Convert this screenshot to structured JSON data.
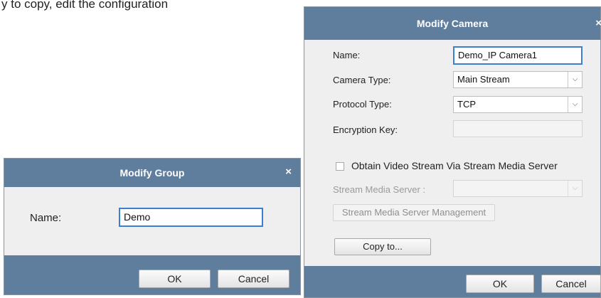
{
  "background_text": "y to copy, edit the configuration",
  "modify_group": {
    "title": "Modify Group",
    "close_glyph": "×",
    "name_label": "Name:",
    "name_value": "Demo",
    "ok_label": "OK",
    "cancel_label": "Cancel"
  },
  "modify_camera": {
    "title": "Modify Camera",
    "close_glyph": "×",
    "name_label": "Name:",
    "name_value": "Demo_IP Camera1",
    "camera_type_label": "Camera Type:",
    "camera_type_value": "Main Stream",
    "protocol_type_label": "Protocol Type:",
    "protocol_type_value": "TCP",
    "encryption_key_label": "Encryption Key:",
    "encryption_key_value": "",
    "obtain_stream_label": "Obtain Video Stream Via Stream Media Server",
    "obtain_stream_checked": false,
    "stream_server_label": "Stream Media Server :",
    "stream_server_value": "",
    "stream_server_mgmt_label": "Stream Media Server Management",
    "copy_to_label": "Copy to...",
    "ok_label": "OK",
    "cancel_label": "Cancel"
  },
  "colors": {
    "titlebar": "#5f7d9c",
    "dialog_bg": "#efefef",
    "focus_border": "#3a7fd0"
  },
  "icons": {
    "close": "close-icon",
    "dropdown": "chevron-down-icon"
  }
}
